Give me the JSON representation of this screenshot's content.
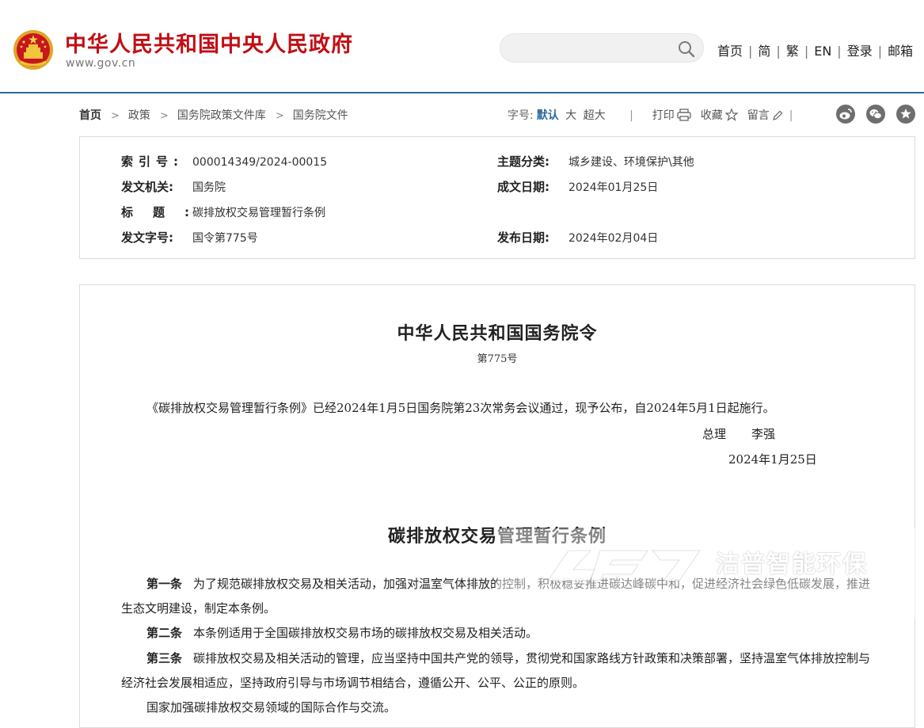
{
  "header": {
    "site_title": "中华人民共和国中央人民政府",
    "site_url": "www.gov.cn",
    "search": {
      "value": "",
      "placeholder": ""
    },
    "nav": [
      {
        "label": "首页"
      },
      {
        "label": "简"
      },
      {
        "label": "繁"
      },
      {
        "label": "EN"
      },
      {
        "label": "登录"
      },
      {
        "label": "邮箱"
      }
    ],
    "brand_color": "#c00f15",
    "accent_color": "#2c6a9c"
  },
  "breadcrumb": [
    "首页",
    "政策",
    "国务院政策文件库",
    "国务院文件"
  ],
  "tools": {
    "font_size_label": "字号:",
    "font_sizes": [
      "默认",
      "大",
      "超大"
    ],
    "selected_font_size": "默认",
    "print": "打印",
    "favorite": "收藏",
    "comment": "留言",
    "share_icons": [
      "weibo-icon",
      "wechat-icon",
      "favorite-star-icon"
    ]
  },
  "info": {
    "index_no": {
      "label": "索引号:",
      "value": "000014349/2024-00015"
    },
    "category": {
      "label": "主题分类:",
      "value": "城乡建设、环境保护\\其他"
    },
    "issuer": {
      "label": "发文机关:",
      "value": "国务院"
    },
    "date_written": {
      "label": "成文日期:",
      "value": "2024年01月25日"
    },
    "title": {
      "label": "标题:",
      "value": "碳排放权交易管理暂行条例"
    },
    "doc_no": {
      "label": "发文字号:",
      "value": "国令第775号"
    },
    "date_published": {
      "label": "发布日期:",
      "value": "2024年02月04日"
    }
  },
  "article": {
    "order_title": "中华人民共和国国务院令",
    "order_no": "第775号",
    "announcement": "《碳排放权交易管理暂行条例》已经2024年1月5日国务院第23次常务会议通过，现予公布，自2024年5月1日起施行。",
    "signer_title": "总理",
    "signer_name": "李强",
    "sign_date": "2024年1月25日",
    "regulation_title": "碳排放权交易管理暂行条例",
    "articles": [
      {
        "no": "第一条",
        "text": "为了规范碳排放权交易及相关活动，加强对温室气体排放的控制，积极稳妥推进碳达峰碳中和，促进经济社会绿色低碳发展，推进生态文明建设，制定本条例。"
      },
      {
        "no": "第二条",
        "text": "本条例适用于全国碳排放权交易市场的碳排放权交易及相关活动。"
      },
      {
        "no": "第三条",
        "text": "碳排放权交易及相关活动的管理，应当坚持中国共产党的领导，贯彻党和国家路线方针政策和决策部署，坚持温室气体排放控制与经济社会发展相适应，坚持政府引导与市场调节相结合，遵循公开、公平、公正的原则。"
      }
    ],
    "extra_paragraph": "国家加强碳排放权交易领域的国际合作与交流。"
  },
  "watermark": {
    "text": "洁普智能环保"
  }
}
